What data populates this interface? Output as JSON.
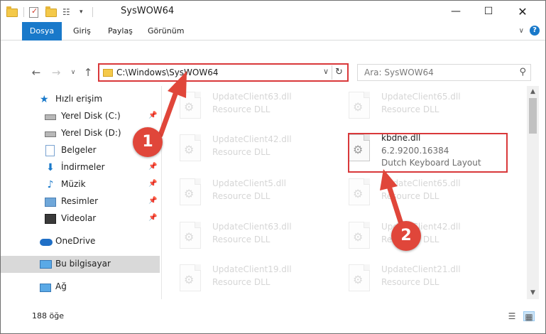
{
  "window": {
    "title": "SysWOW64"
  },
  "ribbon": {
    "tabs": [
      {
        "label": "Dosya"
      },
      {
        "label": "Giriş"
      },
      {
        "label": "Paylaş"
      },
      {
        "label": "Görünüm"
      }
    ]
  },
  "address": {
    "path": "C:\\Windows\\SysWOW64"
  },
  "search": {
    "placeholder": "Ara: SysWOW64"
  },
  "sidebar": {
    "items": [
      {
        "label": "Hızlı erişim",
        "icon": "star-icon"
      },
      {
        "label": "Yerel Disk (C:)",
        "icon": "disk-icon",
        "pinned": true
      },
      {
        "label": "Yerel Disk (D:)",
        "icon": "disk-icon"
      },
      {
        "label": "Belgeler",
        "icon": "document-icon"
      },
      {
        "label": "İndirmeler",
        "icon": "download-icon",
        "pinned": true
      },
      {
        "label": "Müzik",
        "icon": "music-icon",
        "pinned": true
      },
      {
        "label": "Resimler",
        "icon": "pictures-icon",
        "pinned": true
      },
      {
        "label": "Videolar",
        "icon": "video-icon",
        "pinned": true
      },
      {
        "label": "OneDrive",
        "icon": "onedrive-icon"
      },
      {
        "label": "Bu bilgisayar",
        "icon": "pc-icon",
        "selected": true
      },
      {
        "label": "Ağ",
        "icon": "network-icon"
      }
    ]
  },
  "files": [
    {
      "name": "UpdateClient63.dll",
      "desc": "Resource DLL"
    },
    {
      "name": "UpdateClient65.dll",
      "desc": "Resource DLL"
    },
    {
      "name": "UpdateClient42.dll",
      "desc": "Resource DLL"
    },
    {
      "name": "kbdne.dll",
      "desc": "6.2.9200.16384",
      "desc2": "Dutch Keyboard Layout"
    },
    {
      "name": "UpdateClient5.dll",
      "desc": "Resource DLL"
    },
    {
      "name": "UpdateClient65.dll",
      "desc": "Resource DLL"
    },
    {
      "name": "UpdateClient63.dll",
      "desc": "Resource DLL"
    },
    {
      "name": "UpdateClient42.dll",
      "desc": "Resource DLL"
    },
    {
      "name": "UpdateClient19.dll",
      "desc": "Resource DLL"
    },
    {
      "name": "UpdateClient21.dll",
      "desc": "Resource DLL"
    }
  ],
  "status": {
    "count": "188 öğe"
  },
  "callouts": {
    "step1": "1",
    "step2": "2"
  },
  "colors": {
    "accent": "#1979ca",
    "callout": "#e0463a",
    "highlight": "#d9383a"
  }
}
